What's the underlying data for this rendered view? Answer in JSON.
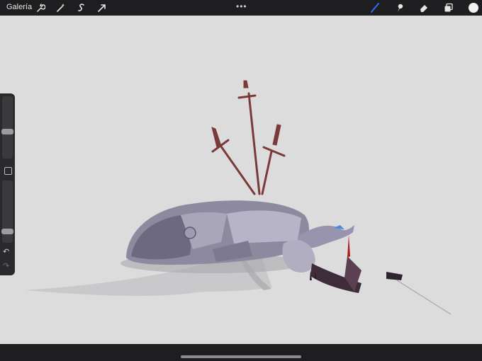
{
  "toolbar": {
    "gallery_label": "Galería",
    "menu_dots": "•••",
    "left_tools": [
      "wrench-icon",
      "magic-wand-icon",
      "selection-icon",
      "transform-icon"
    ],
    "right_tools": [
      "brush-icon",
      "smudge-icon",
      "eraser-icon",
      "layers-icon"
    ],
    "active_tool": "brush-icon",
    "active_color": "#f2f2f2",
    "accent": "#2f6bff"
  },
  "sidebar": {
    "brush_size_level": 0.42,
    "opacity_level": 0.15,
    "undo_glyph": "↶",
    "redo_glyph": "↷"
  },
  "canvas": {
    "background": "#dcdcdc",
    "artwork": "armored-knight-painting"
  }
}
